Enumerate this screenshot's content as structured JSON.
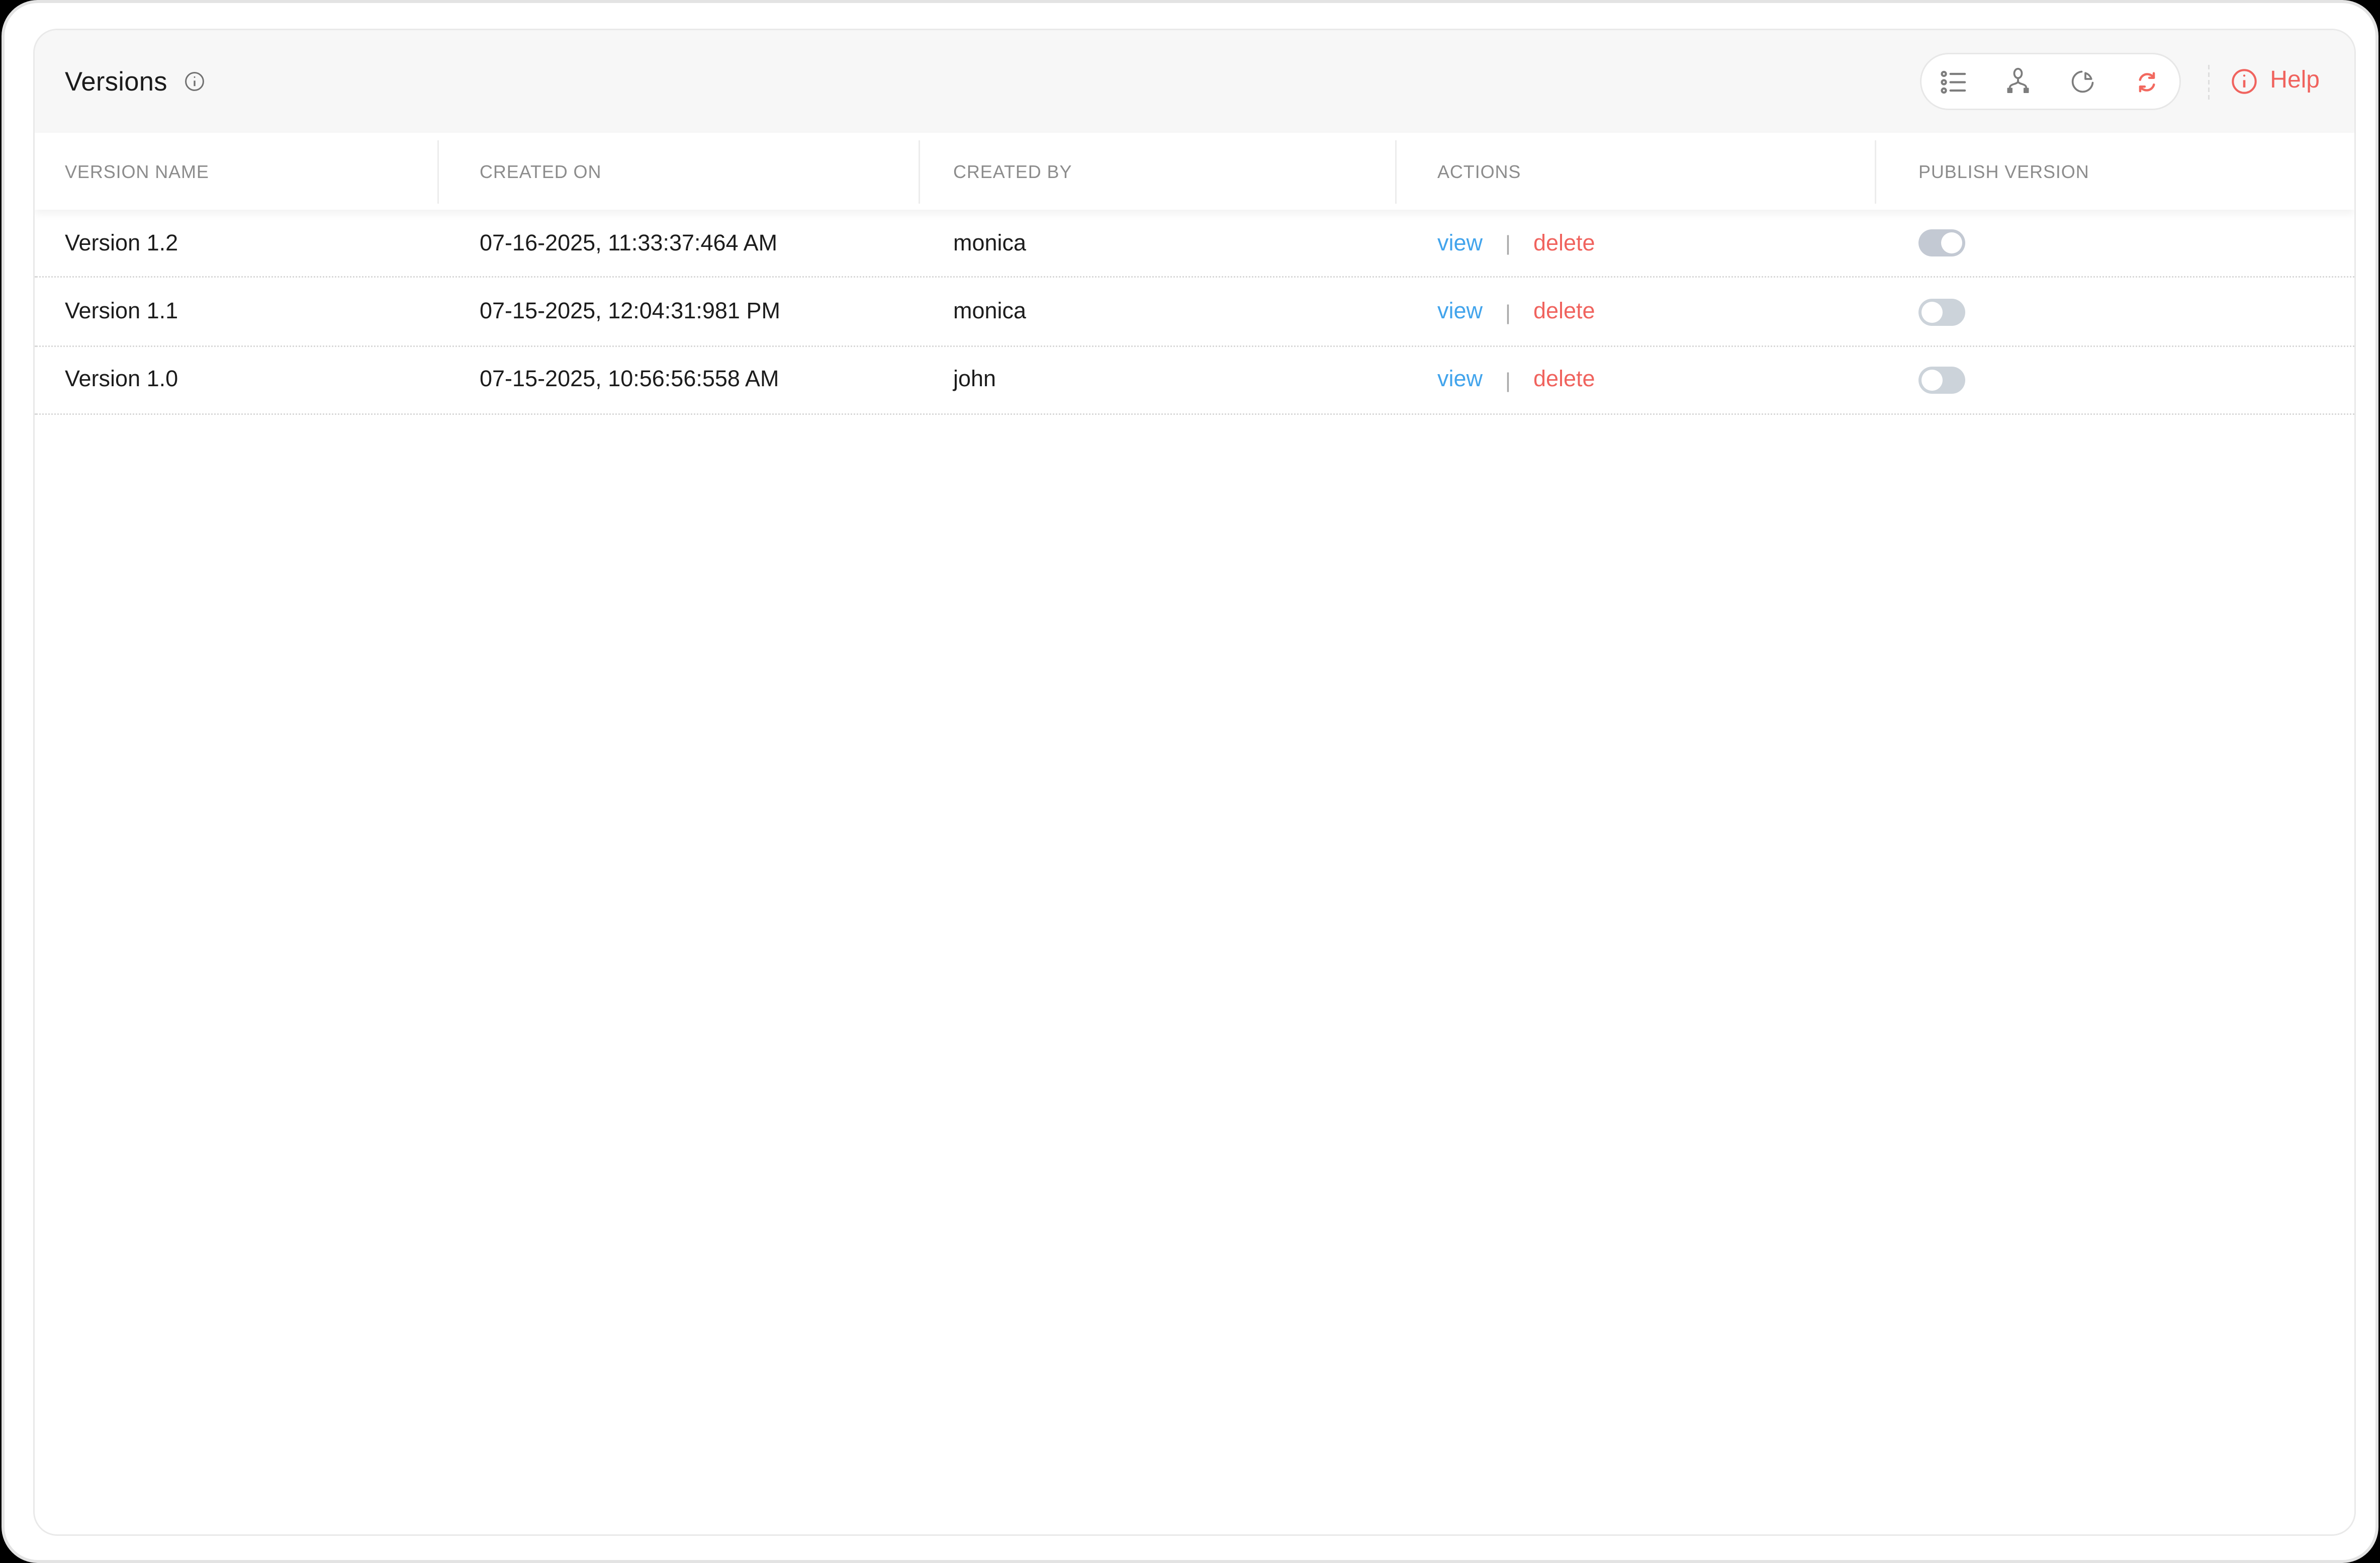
{
  "page": {
    "title": "Versions"
  },
  "toolbar": {
    "view_icons": [
      "list-view-icon",
      "flow-view-icon",
      "pie-chart-view-icon",
      "refresh-icon"
    ],
    "help_label": "Help"
  },
  "table": {
    "columns": [
      "VERSION NAME",
      "CREATED ON",
      "CREATED BY",
      "ACTIONS",
      "PUBLISH VERSION"
    ],
    "actions": {
      "view_label": "view",
      "separator": "|",
      "delete_label": "delete"
    },
    "rows": [
      {
        "version_name": "Version 1.2",
        "created_on": "07-16-2025, 11:33:37:464 AM",
        "created_by": "monica",
        "published": true
      },
      {
        "version_name": "Version 1.1",
        "created_on": "07-15-2025, 12:04:31:981 PM",
        "created_by": "monica",
        "published": false
      },
      {
        "version_name": "Version 1.0",
        "created_on": "07-15-2025, 10:56:56:558 AM",
        "created_by": "john",
        "published": false
      }
    ]
  },
  "colors": {
    "view_link": "#42a4ec",
    "delete_link": "#f0635e",
    "help_accent": "#f0635e",
    "refresh_icon": "#f2695f",
    "toggle_on_track": "#c3c9d3",
    "toggle_off_track": "#ccd3da",
    "header_band": "#f7f7f7",
    "column_header_text": "#8c8c8c"
  }
}
